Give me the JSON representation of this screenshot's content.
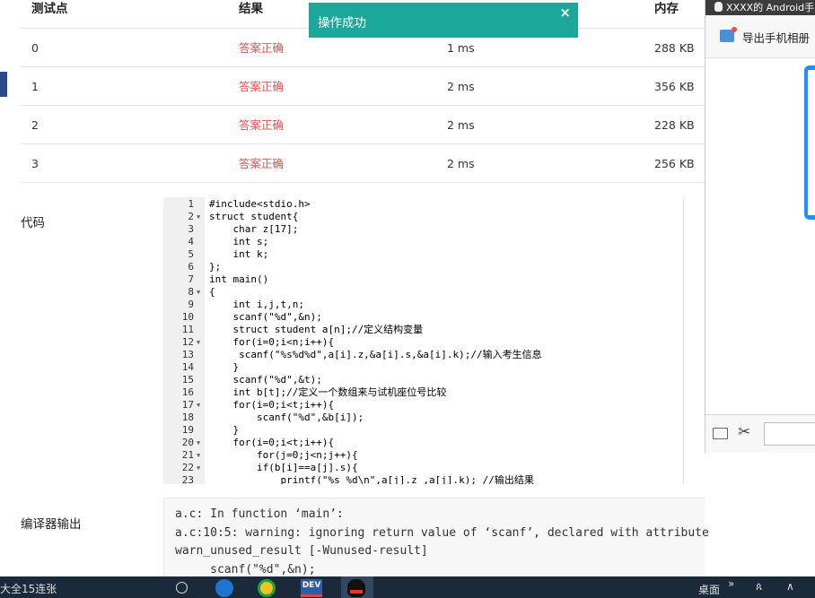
{
  "results": {
    "headers": [
      "测试点",
      "结果",
      "",
      "内存"
    ],
    "rows": [
      {
        "point": "0",
        "result": "答案正确",
        "time": "1 ms",
        "memory": "288 KB"
      },
      {
        "point": "1",
        "result": "答案正确",
        "time": "2 ms",
        "memory": "356 KB"
      },
      {
        "point": "2",
        "result": "答案正确",
        "time": "2 ms",
        "memory": "228 KB"
      },
      {
        "point": "3",
        "result": "答案正确",
        "time": "2 ms",
        "memory": "256 KB"
      }
    ]
  },
  "toast": {
    "message": "操作成功",
    "close": "×"
  },
  "code_label": "代码",
  "compiler_label": "编译器输出",
  "code": [
    "#include<stdio.h>",
    "struct student{",
    "    char z[17];",
    "    int s;",
    "    int k;",
    "};",
    "int main()",
    "{",
    "    int i,j,t,n;",
    "    scanf(\"%d\",&n);",
    "    struct student a[n];//定义结构变量",
    "    for(i=0;i<n;i++){",
    "     scanf(\"%s%d%d\",a[i].z,&a[i].s,&a[i].k);//输入考生信息",
    "    }",
    "    scanf(\"%d\",&t);",
    "    int b[t];//定义一个数组来与试机座位号比较",
    "    for(i=0;i<t;i++){",
    "        scanf(\"%d\",&b[i]);",
    "    }",
    "    for(i=0;i<t;i++){",
    "        for(j=0;j<n;j++){",
    "        if(b[i]==a[j].s){",
    "            printf(\"%s %d\\n\",a[j].z ,a[j].k); //输出结果"
  ],
  "fold_lines": [
    2,
    8,
    12,
    17,
    20,
    21,
    22
  ],
  "compiler_output": "a.c: In function ‘main’:\na.c:10:5: warning: ignoring return value of ‘scanf’, declared with attribute\nwarn_unused_result [-Wunused-result]\n     scanf(\"%d\",&n);",
  "chat": {
    "title": "XXXX的 Android手",
    "export_label": "导出手机相册"
  },
  "taskbar": {
    "search_text": "大全15连张",
    "dev_label": "DEV",
    "desktop_label": "桌面",
    "sys_more": "»",
    "sys_people": "ጰ",
    "sys_up": "∧"
  },
  "colors": {
    "accent_toast": "#1ba89a",
    "ok_text": "#e2534e"
  }
}
